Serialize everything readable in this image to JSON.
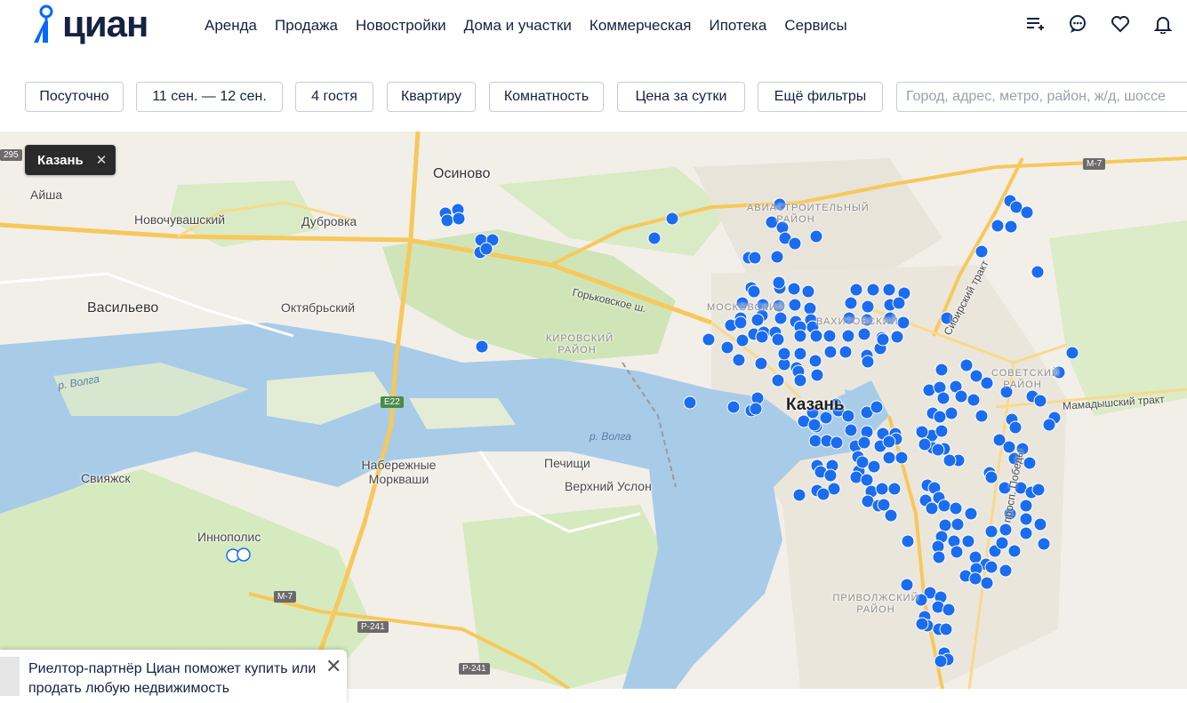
{
  "brand": {
    "logo_text": "циан"
  },
  "nav": [
    "Аренда",
    "Продажа",
    "Новостройки",
    "Дома и участки",
    "Коммерческая",
    "Ипотека",
    "Сервисы"
  ],
  "header_icons": [
    "compare-list-icon",
    "chat-icon",
    "favorites-heart-icon",
    "notifications-bell-icon"
  ],
  "filters": {
    "rent_type": "Посуточно",
    "dates": "11 сен. — 12 сен.",
    "guests": "4 гостя",
    "property_type": "Квартиру",
    "rooms": "Комнатность",
    "price": "Цена за сутки",
    "more": "Ещё фильтры",
    "search_placeholder": "Город, адрес, метро, район, ж/д, шоссе"
  },
  "map": {
    "selected_city": "Казань",
    "labels": {
      "osinovo": "Осиново",
      "aisha": "Айша",
      "novochuvashsky": "Новочувашский",
      "dubrovka": "Дубровка",
      "vasilevo": "Васильево",
      "oktyabrsky": "Октябрьский",
      "gorkovskoe": "Горьковское ш.",
      "volga1": "р. Волга",
      "volga2": "р. Волга",
      "kazan": "Казань",
      "sviyazhsk": "Свияжск",
      "naberezhnye_morkvashi": "Набережные Моркваши",
      "pechishchi": "Печищи",
      "verkhny_uslon": "Верхний Услон",
      "innopolis": "Иннополис",
      "sibirsky_trakt": "Сибирский тракт",
      "mamadyshsky_trakt": "Мамадышский тракт",
      "prospekt_pobedy": "просп. Победы",
      "aviastroitelny": "АВИАСТРОИТЕЛЬНЫЙ РАЙОН",
      "kirovsky": "КИРОВСКИЙ РАЙОН",
      "moskovsky": "МОСКОВСКИЙ",
      "sovetsky": "СОВЕТСКИЙ РАЙОН",
      "privolzhsky": "ПРИВОЛЖСКИЙ РАЙОН",
      "vakhitovsky": "ВАХИТОВСКИЙ"
    },
    "road_signs": [
      "295",
      "M-7",
      "E22",
      "M-7",
      "P-241",
      "P-241"
    ]
  },
  "popup": {
    "text": "Риелтор-партнёр Циан поможет купить или продать любую недвижимость"
  },
  "colors": {
    "marker": "#1a6cf0",
    "brand_blue": "#0468ff",
    "brand_dark": "#152242",
    "water": "#a8cbe8",
    "forest": "#cfe5b8",
    "road": "#f7c85a"
  }
}
